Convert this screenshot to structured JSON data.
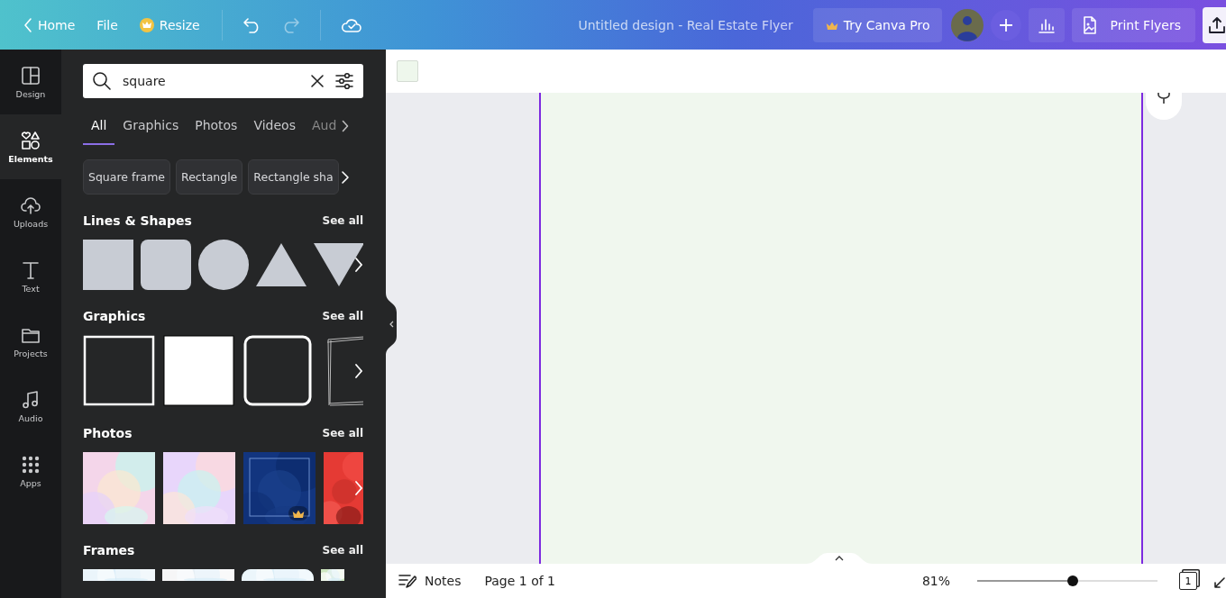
{
  "topbar": {
    "nav": [
      {
        "kind": "back",
        "label": "Home"
      },
      {
        "kind": "plain",
        "label": "File"
      },
      {
        "kind": "crown",
        "label": "Resize"
      }
    ],
    "title": "Untitled design - Real Estate Flyer",
    "pro_button": "Try Canva Pro",
    "print_button": "Print Flyers"
  },
  "rail": [
    {
      "kind": "design",
      "label": "Design",
      "selected": false
    },
    {
      "kind": "elements",
      "label": "Elements",
      "selected": true
    },
    {
      "kind": "uploads",
      "label": "Uploads",
      "selected": false
    },
    {
      "kind": "text",
      "label": "Text",
      "selected": false
    },
    {
      "kind": "projects",
      "label": "Projects",
      "selected": false
    },
    {
      "kind": "audio",
      "label": "Audio",
      "selected": false
    },
    {
      "kind": "apps",
      "label": "Apps",
      "selected": false
    }
  ],
  "search": {
    "value": "square"
  },
  "tabs": [
    {
      "label": "All",
      "selected": true
    },
    {
      "label": "Graphics",
      "selected": false
    },
    {
      "label": "Photos",
      "selected": false
    },
    {
      "label": "Videos",
      "selected": false
    },
    {
      "label": "Aud",
      "selected": false
    }
  ],
  "chips": [
    "Square frame",
    "Rectangle",
    "Rectangle sha"
  ],
  "sections": [
    {
      "title": "Lines & Shapes",
      "link": "See all",
      "kind": "shapes",
      "items": [
        {
          "kind": "square"
        },
        {
          "kind": "rounded"
        },
        {
          "kind": "circle"
        },
        {
          "kind": "triangle"
        },
        {
          "kind": "down-triangle"
        }
      ]
    },
    {
      "title": "Graphics",
      "link": "See all",
      "kind": "graphics",
      "items": [
        {
          "kind": "outline"
        },
        {
          "kind": "filled"
        },
        {
          "kind": "rounded-outline"
        },
        {
          "kind": "sketch"
        }
      ]
    },
    {
      "title": "Photos",
      "link": "See all",
      "kind": "photos",
      "items": [
        {
          "kind": "picture",
          "pro": false
        },
        {
          "kind": "picture",
          "pro": false
        },
        {
          "kind": "picture",
          "pro": true
        },
        {
          "kind": "picture",
          "pro": false
        }
      ]
    },
    {
      "title": "Frames",
      "link": "See all",
      "kind": "frames",
      "items": [
        {
          "kind": "picture"
        },
        {
          "kind": "picture"
        },
        {
          "kind": "picture"
        },
        {
          "kind": "picture"
        }
      ]
    }
  ],
  "footer": {
    "notes": "Notes",
    "page": "Page 1 of 1",
    "zoom": "81%",
    "zoom_slider": {
      "level": 0.53
    },
    "page_count": "1"
  }
}
